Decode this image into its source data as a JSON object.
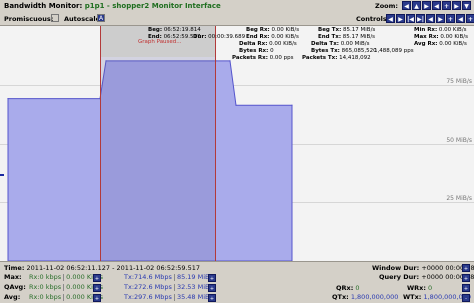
{
  "header": {
    "title_prefix": "Bandwidth Monitor: ",
    "interface": "p1p1",
    "title_suffix": " - shopper2 Monitor Interface",
    "zoom_label": "Zoom:",
    "zoom_buttons": [
      "◀",
      "▲",
      "▶",
      "◀",
      "+",
      "▶",
      "▼"
    ],
    "promiscuous_label": "Promiscuous:",
    "autoscale_label": "Autoscale:",
    "controls_label": "Controls:",
    "control_buttons": [
      "◀",
      "▶",
      "|◀",
      "▶|",
      "◀",
      "▶",
      "+",
      "◀",
      "+",
      "▶"
    ]
  },
  "info": {
    "beg_label": "Beg:",
    "beg": "06:52:19.814",
    "end_label": "End:",
    "end": "06:52:59.517",
    "dur_label": "Dur:",
    "dur": "00:00:39.689",
    "paused": "Graph Paused...",
    "beg_rx_label": "Beg Rx:",
    "beg_rx": "0.00 KiB/s",
    "end_rx_label": "End Rx:",
    "end_rx": "0.00 KiB/s",
    "delta_rx_label": "Delta Rx:",
    "delta_rx": "0.00 KiB/s",
    "bytes_rx_label": "Bytes Rx:",
    "bytes_rx": "0",
    "packets_rx_label": "Packets Rx:",
    "packets_rx": "0.00 pps",
    "beg_tx_label": "Beg Tx:",
    "beg_tx": "85.17 MiB/s",
    "end_tx_label": "End Tx:",
    "end_tx": "85.17 MiB/s",
    "delta_tx_label": "Delta Tx:",
    "delta_tx": "0.00 MiB/s",
    "bytes_tx_label": "Bytes Tx:",
    "bytes_tx": "865,085,520",
    "packets_tx_label": "Packets Tx:",
    "packets_tx": "14,418,092",
    "min_rx_label": "Min Rx:",
    "min_rx": "0.00 KiB/s",
    "max_rx_label": "Max Rx:",
    "max_rx": "0.00 KiB/s",
    "avg_rx_label": "Avg Rx:",
    "avg_rx": "0.00 KiB/s",
    "min_tx_label": "Min Tx:",
    "min_tx": "85.10 MiB/s",
    "max_tx_label": "Max Tx:",
    "max_tx": "85.19 MiB/s",
    "avg_tx_label": "Avg Tx:",
    "avg_tx": "85.12 MiB/s",
    "pps_tx": "1,488,089 pps"
  },
  "y_axis": {
    "label_75": "75 MiB/s",
    "label_50": "50 MiB/s",
    "label_25": "25 MiB/s"
  },
  "footer": {
    "time_label": "Time:",
    "time_start": "2011-11-02 06:52:11.127",
    "time_sep": " - ",
    "time_end": "2011-11-02 06:52:59.517",
    "max_label": "Max:",
    "max_rx": "Rx:0 kbps",
    "max_rx2": "0.000 KiB/s",
    "max_tx": "Tx:714.6 Mbps",
    "max_tx2": "85.19 MiB/s",
    "qavg_label": "QAvg:",
    "qavg_rx": "Rx:0 kbps",
    "qavg_rx2": "0.000 KiB/s",
    "qavg_tx": "Tx:272.6 Mbps",
    "qavg_tx2": "32.53 MiB/s",
    "avg_label": "Avg:",
    "avg_rx": "Rx:0 kbps",
    "avg_rx2": "0.000 KiB/s",
    "avg_tx": "Tx:297.6 Mbps",
    "avg_tx2": "35.48 MiB/s",
    "window_dur_label": "Window Dur:",
    "window_dur": "+0000 00:00:48",
    "query_dur_label": "Query Dur:",
    "query_dur": "+0000 00:00:48",
    "qrx_label": "QRx:",
    "qrx": "0",
    "qtx_label": "QTx:",
    "qtx": "1,800,000,000",
    "wrx_label": "WRx:",
    "wrx": "0",
    "wtx_label": "WTx:",
    "wtx": "1,800,000,000",
    "btn_plus": "+",
    "btn_minus": "-"
  },
  "chart_data": {
    "type": "area",
    "x": [
      "06:52:11.1",
      "06:52:19.8",
      "06:52:29.7",
      "06:52:39.6",
      "06:52:47.5",
      "06:52:52.0",
      "06:52:59.5"
    ],
    "values": [
      69.1,
      69.1,
      85.17,
      85.17,
      85.17,
      66.3,
      66.3
    ],
    "ylim": [
      0,
      100
    ],
    "colors": {
      "fill": "#a9abeb",
      "line": "#5555cc"
    }
  }
}
